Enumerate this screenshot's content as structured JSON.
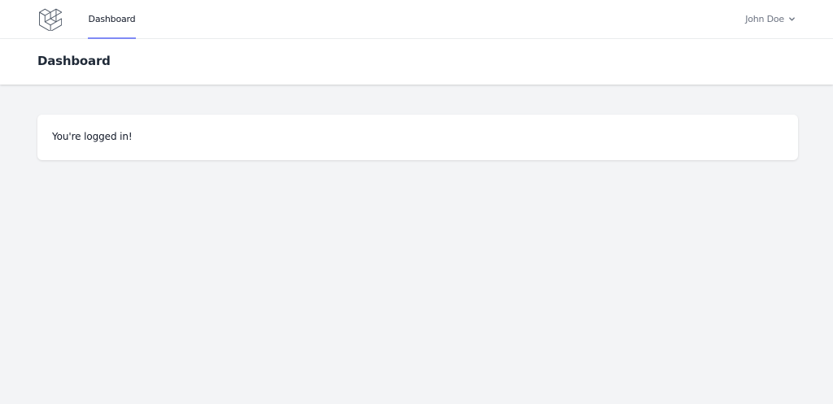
{
  "nav": {
    "logo_icon": "laravel-logo-icon",
    "links": [
      {
        "label": "Dashboard",
        "active": true
      }
    ],
    "user": {
      "name": "John Doe",
      "icon": "chevron-down-icon"
    },
    "active_underline_color": "#818cf8"
  },
  "header": {
    "title": "Dashboard"
  },
  "content": {
    "message": "You're logged in!"
  },
  "colors": {
    "page_background": "#f3f4f6",
    "surface": "#ffffff",
    "text_primary": "#1f2937",
    "text_muted": "#6b7280"
  }
}
